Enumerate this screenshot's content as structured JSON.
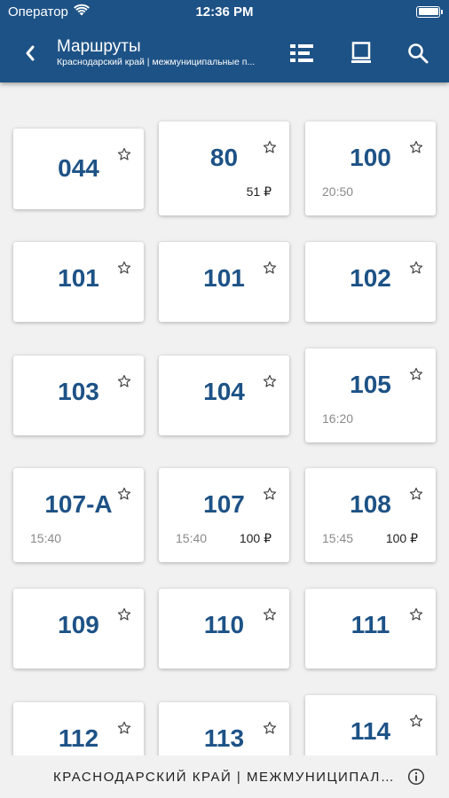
{
  "status_bar": {
    "carrier": "Оператор",
    "time": "12:36 PM"
  },
  "header": {
    "title": "Маршруты",
    "subtitle": "Краснодарский край | межмуниципальные п..."
  },
  "routes": [
    {
      "number": "044",
      "time": "",
      "price": ""
    },
    {
      "number": "80",
      "time": "",
      "price": "51 ₽"
    },
    {
      "number": "100",
      "time": "20:50",
      "price": ""
    },
    {
      "number": "101",
      "time": "",
      "price": ""
    },
    {
      "number": "101",
      "time": "",
      "price": ""
    },
    {
      "number": "102",
      "time": "",
      "price": ""
    },
    {
      "number": "103",
      "time": "",
      "price": ""
    },
    {
      "number": "104",
      "time": "",
      "price": ""
    },
    {
      "number": "105",
      "time": "16:20",
      "price": ""
    },
    {
      "number": "107-А",
      "time": "15:40",
      "price": ""
    },
    {
      "number": "107",
      "time": "15:40",
      "price": "100 ₽"
    },
    {
      "number": "108",
      "time": "15:45",
      "price": "100 ₽"
    },
    {
      "number": "109",
      "time": "",
      "price": ""
    },
    {
      "number": "110",
      "time": "",
      "price": ""
    },
    {
      "number": "111",
      "time": "",
      "price": ""
    },
    {
      "number": "112",
      "time": "",
      "price": ""
    },
    {
      "number": "113",
      "time": "",
      "price": ""
    },
    {
      "number": "114",
      "time": "",
      "price": ""
    }
  ],
  "footer": {
    "label": "КРАСНОДАРСКИЙ КРАЙ | МЕЖМУНИЦИПАЛЬ..."
  },
  "colors": {
    "brand": "#1d5286",
    "background": "#f1f1f1"
  }
}
